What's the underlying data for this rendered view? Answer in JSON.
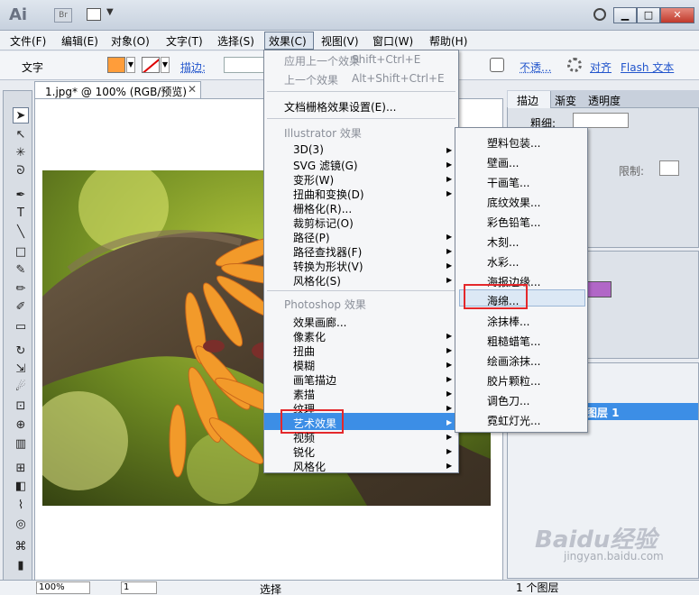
{
  "titlebar": {
    "logo": "Ai",
    "bridge": "Br",
    "window_buttons": [
      "▁",
      "□",
      "✕"
    ]
  },
  "menubar": {
    "items": [
      "文件(F)",
      "编辑(E)",
      "对象(O)",
      "文字(T)",
      "选择(S)",
      "效果(C)",
      "视图(V)",
      "窗口(W)",
      "帮助(H)"
    ],
    "active": "效果(C)"
  },
  "controlbar": {
    "tool_label": "文字",
    "fill_color": "#ff9d3a",
    "stroke_label": "描边:",
    "opacity_label": "不透...",
    "align_label": "对齐",
    "flash_label": "Flash 文本"
  },
  "document": {
    "tab_label": "1.jpg* @ 100% (RGB/预览)",
    "close_glyph": "✕"
  },
  "effect_menu": {
    "apply_last": "应用上一个效果",
    "apply_last_shortcut": "Shift+Ctrl+E",
    "last_effect": "上一个效果",
    "last_effect_shortcut": "Alt+Shift+Ctrl+E",
    "raster_settings": "文档栅格效果设置(E)...",
    "illustrator_header": "Illustrator 效果",
    "illustrator_items": [
      "3D(3)",
      "SVG 滤镜(G)",
      "变形(W)",
      "扭曲和变换(D)",
      "栅格化(R)...",
      "裁剪标记(O)",
      "路径(P)",
      "路径查找器(F)",
      "转换为形状(V)",
      "风格化(S)"
    ],
    "photoshop_header": "Photoshop 效果",
    "photoshop_items": [
      "效果画廊...",
      "像素化",
      "扭曲",
      "模糊",
      "画笔描边",
      "素描",
      "纹理",
      "艺术效果",
      "视频",
      "锐化",
      "风格化"
    ],
    "highlighted": "艺术效果"
  },
  "art_submenu": {
    "items": [
      "塑料包装...",
      "壁画...",
      "干画笔...",
      "底纹效果...",
      "彩色铅笔...",
      "木刻...",
      "水彩...",
      "海报边缘...",
      "海绵...",
      "涂抹棒...",
      "粗糙蜡笔...",
      "绘画涂抹...",
      "胶片颗粒...",
      "调色刀...",
      "霓虹灯光..."
    ],
    "highlighted": "海绵..."
  },
  "right_panel": {
    "tabs": [
      "描边",
      "渐变",
      "透明度"
    ],
    "weight_label": "粗细:",
    "limit_label": "限制:",
    "swatch_color": "#b167c7",
    "layer_name": "图层 1"
  },
  "statusbar": {
    "zoom": "100%",
    "page": "1",
    "status": "选择",
    "layers_count": "1 个图层"
  },
  "watermark": {
    "brand": "Baidu经验",
    "url": "jingyan.baidu.com"
  }
}
